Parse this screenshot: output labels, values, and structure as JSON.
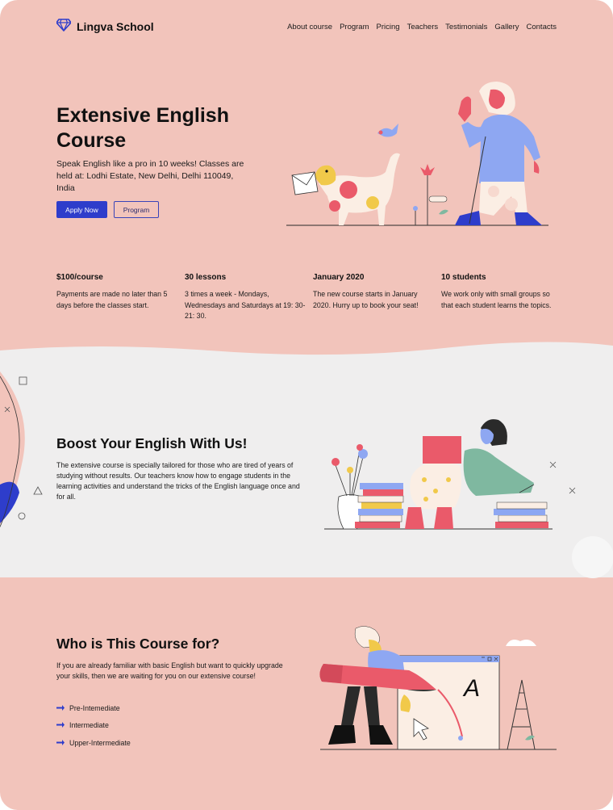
{
  "brand": {
    "name": "Lingva School",
    "logo_icon": "diamond-icon",
    "logo_color": "#2e3dcb"
  },
  "nav": [
    "About course",
    "Program",
    "Pricing",
    "Teachers",
    "Testimonials",
    "Gallery",
    "Contacts"
  ],
  "hero": {
    "title": "Extensive English Course",
    "subtitle": "Speak English like a pro in 10 weeks! Classes are held at: Lodhi Estate, New Delhi, Delhi 110049, India",
    "apply_label": "Apply Now",
    "program_label": "Program"
  },
  "features": [
    {
      "title": "$100/course",
      "text": "Payments are made no later than 5 days before the classes start."
    },
    {
      "title": "30 lessons",
      "text": "3 times a week - Mondays, Wednesdays and Saturdays at 19: 30-21: 30."
    },
    {
      "title": "January 2020",
      "text": "The new course starts in January 2020. Hurry up to book your seat!"
    },
    {
      "title": "10 students",
      "text": "We work only with small groups so that each student learns the topics."
    }
  ],
  "boost": {
    "title": "Boost Your English With Us!",
    "text": "The extensive course is specially tailored for those who are tired of years of studying without results. Our teachers know how to engage students in the learning activities and understand the tricks of the English language once and for all."
  },
  "who": {
    "title": "Who is This Course for?",
    "text": "If you are already familiar with basic English but want to quickly upgrade your skills, then we are waiting for you on our extensive course!",
    "levels": [
      "Pre-Intemediate",
      "Intermediate",
      "Upper-Intermediate"
    ],
    "level_icon": "arrow-right-icon",
    "board_letter": "A"
  },
  "colors": {
    "background": "#f2c4bb",
    "band": "#efeeee",
    "accent": "#2e3dcb",
    "illustration_blue": "#8ea7f2",
    "illustration_red": "#ea5a6a",
    "illustration_yellow": "#f1c94a",
    "illustration_green": "#7fb8a0"
  }
}
